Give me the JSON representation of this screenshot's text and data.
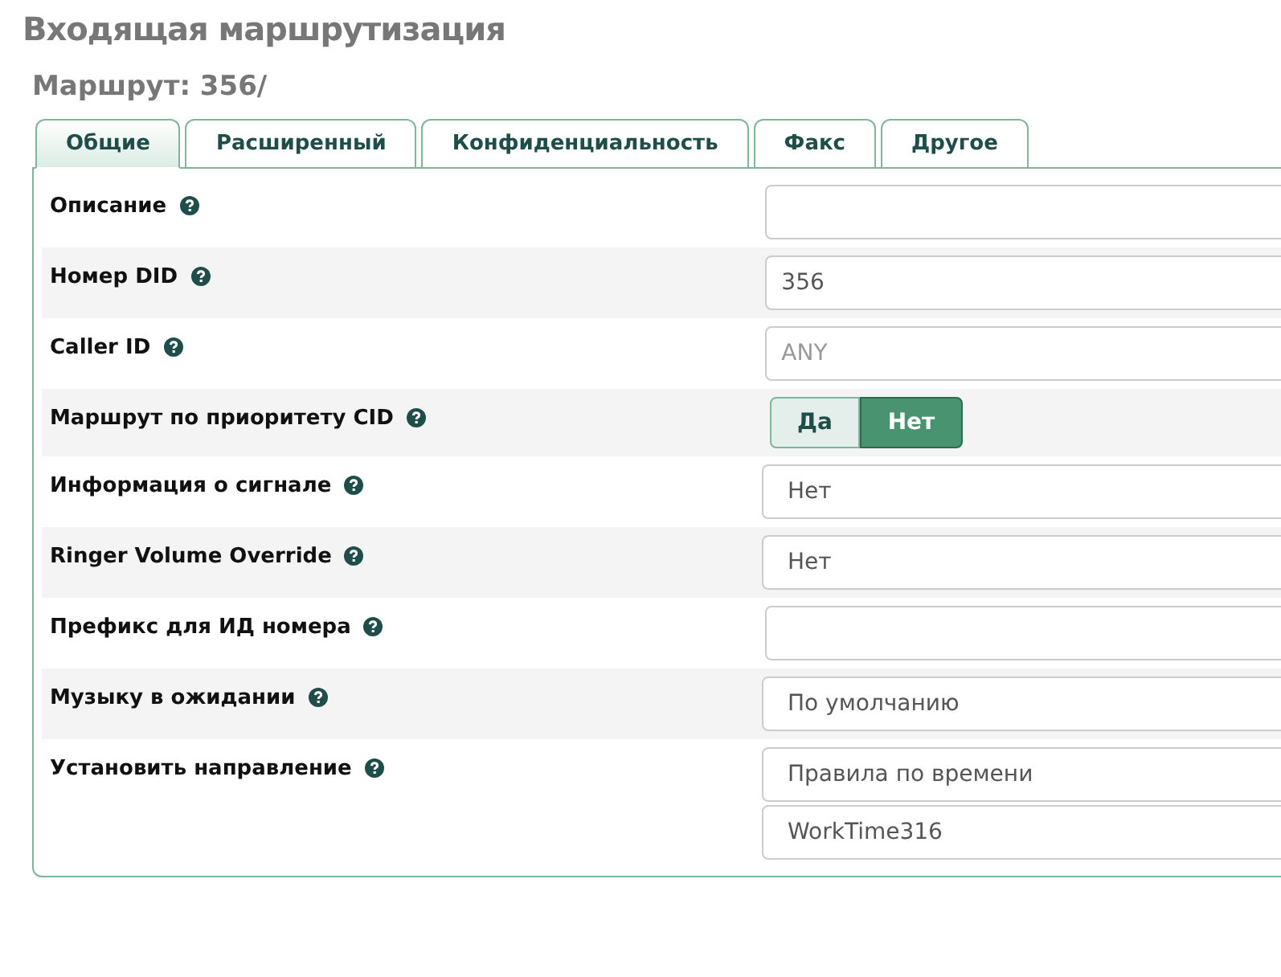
{
  "page_title": "Входящая маршрутизация",
  "route_title": "Маршрут: 356/",
  "tabs": [
    {
      "label": "Общие",
      "selected": true
    },
    {
      "label": "Расширенный",
      "selected": false
    },
    {
      "label": "Конфиденциальность",
      "selected": false
    },
    {
      "label": "Факс",
      "selected": false
    },
    {
      "label": "Другое",
      "selected": false
    }
  ],
  "rows": [
    {
      "kind": "text",
      "label": "Описание",
      "value": ""
    },
    {
      "kind": "text",
      "label": "Номер DID",
      "value": "356"
    },
    {
      "kind": "text",
      "label": "Caller ID",
      "placeholder": "ANY"
    },
    {
      "kind": "toggle",
      "label": "Маршрут по приоритету CID",
      "options": [
        {
          "label": "Да",
          "selected": false
        },
        {
          "label": "Нет",
          "selected": true
        }
      ]
    },
    {
      "kind": "select",
      "label": "Информация о сигнале",
      "values": [
        "Нет"
      ]
    },
    {
      "kind": "select",
      "label": "Ringer Volume Override",
      "values": [
        "Нет"
      ]
    },
    {
      "kind": "text",
      "label": "Префикс для ИД номера",
      "value": ""
    },
    {
      "kind": "select",
      "label": "Музыку в ожидании",
      "values": [
        "По умолчанию"
      ]
    },
    {
      "kind": "select",
      "label": "Установить направление",
      "values": [
        "Правила по времени",
        "WorkTime316"
      ]
    }
  ]
}
